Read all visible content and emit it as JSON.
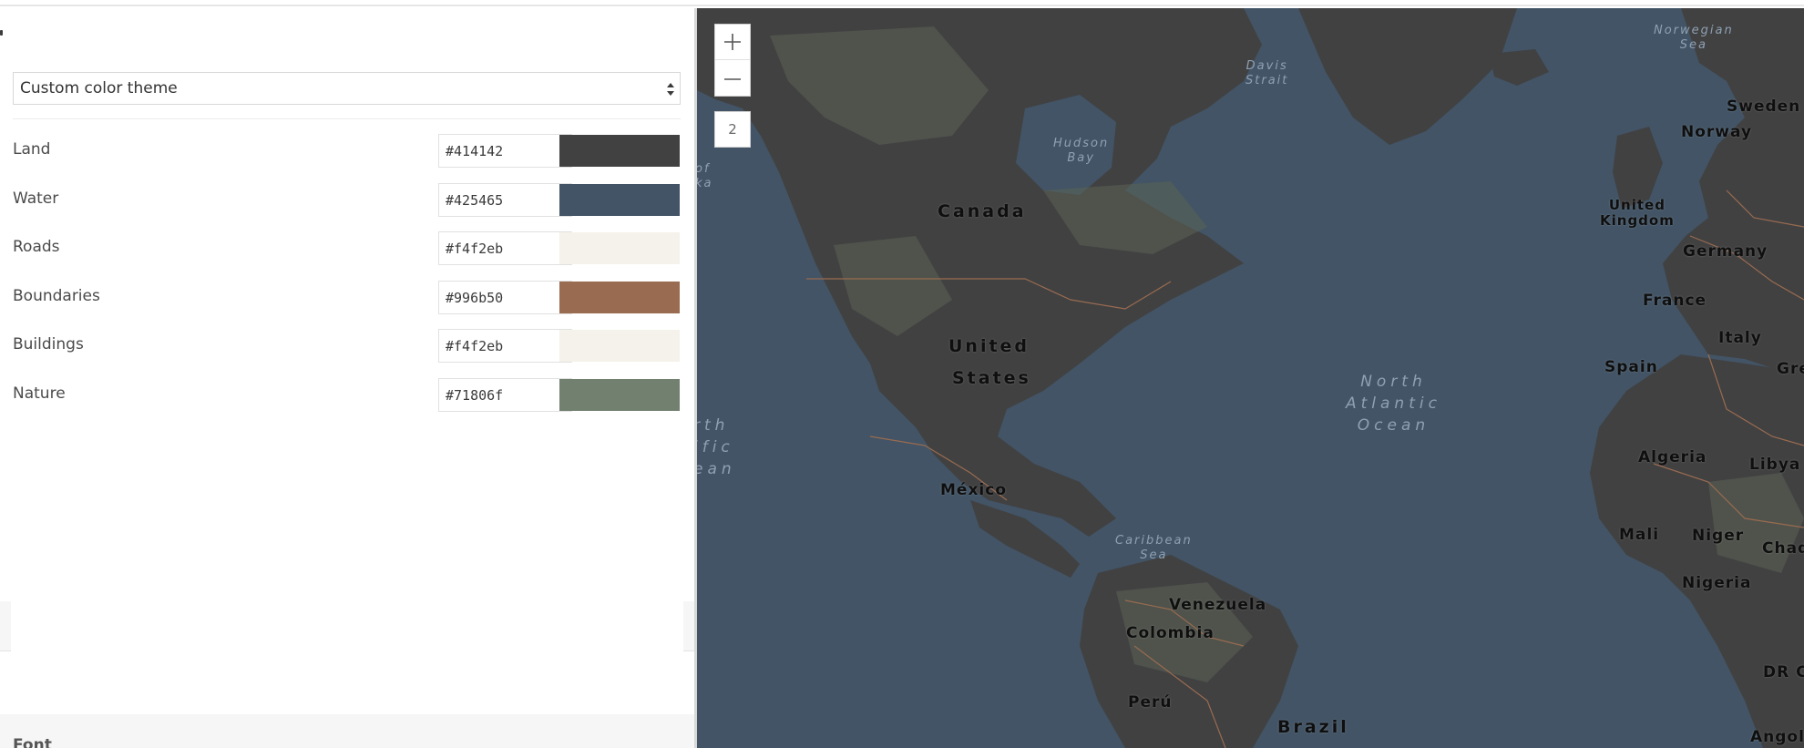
{
  "colors": {
    "panel_bg": "#ffffff",
    "map_water": "#425465",
    "map_land": "#414142",
    "map_nature": "#71806f",
    "map_boundary": "#996b50"
  },
  "theme_select": {
    "value": "Custom color theme",
    "icon": "sort-arrows-icon"
  },
  "color_rows": [
    {
      "label": "Land",
      "hex": "#414142",
      "swatch": "#414142"
    },
    {
      "label": "Water",
      "hex": "#425465",
      "swatch": "#425465"
    },
    {
      "label": "Roads",
      "hex": "#f4f2eb",
      "swatch": "#f4f2eb"
    },
    {
      "label": "Boundaries",
      "hex": "#996b50",
      "swatch": "#996b50"
    },
    {
      "label": "Buildings",
      "hex": "#f4f2eb",
      "swatch": "#f4f2eb"
    },
    {
      "label": "Nature",
      "hex": "#71806f",
      "swatch": "#71806f"
    }
  ],
  "font_section": {
    "label": "Font"
  },
  "map": {
    "zoom_in_icon": "plus-icon",
    "zoom_out_icon": "minus-icon",
    "zoom_level": "2",
    "labels": {
      "canada": "Canada",
      "united": "United",
      "states": "States",
      "mexico": "México",
      "venezuela": "Venezuela",
      "colombia": "Colombia",
      "peru": "Perú",
      "brazil": "Brazil",
      "united_kingdom_1": "United",
      "united_kingdom_2": "Kingdom",
      "norway": "Norway",
      "sweden": "Sweden",
      "germany": "Germany",
      "france": "France",
      "spain": "Spain",
      "italy": "Italy",
      "gre": "Gre",
      "algeria": "Algeria",
      "libya": "Libya",
      "mali": "Mali",
      "niger": "Niger",
      "chad": "Chad",
      "nigeria": "Nigeria",
      "dr_c": "DR C",
      "angola": "Angola",
      "north_atlantic_1": "North",
      "north_atlantic_2": "Atlantic",
      "north_atlantic_3": "Ocean",
      "north_pacific_1": "rth",
      "north_pacific_2": "ific",
      "north_pacific_3": "ean",
      "hudson_1": "Hudson",
      "hudson_2": "Bay",
      "davis_1": "Davis",
      "davis_2": "Strait",
      "caribbean_1": "Caribbean",
      "caribbean_2": "Sea",
      "norwegian_1": "Norwegian",
      "norwegian_2": "Sea",
      "alaska_1": "of",
      "alaska_2": "ka"
    }
  }
}
